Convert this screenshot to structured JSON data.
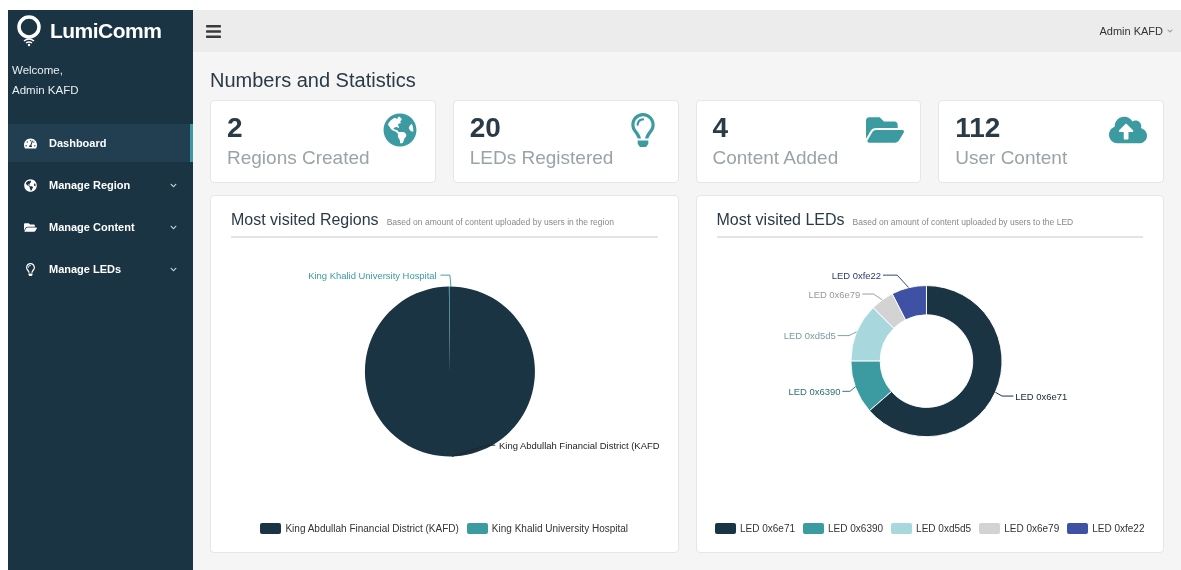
{
  "sidebar": {
    "brand": "LumiComm",
    "welcome": "Welcome,",
    "user": "Admin KAFD",
    "items": [
      {
        "label": "Dashboard",
        "selected": true,
        "has_children": false
      },
      {
        "label": "Manage Region",
        "selected": false,
        "has_children": true
      },
      {
        "label": "Manage Content",
        "selected": false,
        "has_children": true
      },
      {
        "label": "Manage LEDs",
        "selected": false,
        "has_children": true
      }
    ]
  },
  "topbar": {
    "user": "Admin KAFD"
  },
  "page_title": "Numbers and Statistics",
  "stats": [
    {
      "value": "2",
      "label": "Regions Created"
    },
    {
      "value": "20",
      "label": "LEDs Registered"
    },
    {
      "value": "4",
      "label": "Content Added"
    },
    {
      "value": "112",
      "label": "User Content"
    }
  ],
  "charts": [
    {
      "kind": "pie",
      "title": "Most visited Regions",
      "subtitle": "Based on amount of content uploaded by users in the region",
      "slices": [
        {
          "label": "King Khalid University Hospital",
          "color": "#3b9ba0"
        },
        {
          "label": "King Abdullah Financial District (KAFD",
          "color": "#1b3444"
        }
      ],
      "legend": [
        {
          "label": "King Abdullah Financial District (KAFD)",
          "color": "#1b3444"
        },
        {
          "label": "King Khalid University Hospital",
          "color": "#3b9ba0"
        }
      ]
    },
    {
      "kind": "donut",
      "title": "Most visited LEDs",
      "subtitle": "Based on amount of content uploaded by users to the LED",
      "slices": [
        {
          "label": "LED 0xfe22",
          "color": "#3f51a5"
        },
        {
          "label": "LED 0x6e79",
          "color": "#d3d3d3"
        },
        {
          "label": "LED 0xd5d5",
          "color": "#a8d8de"
        },
        {
          "label": "LED 0x6390",
          "color": "#3b9ba0"
        },
        {
          "label": "LED 0x6e71",
          "color": "#1b3444"
        }
      ],
      "legend": [
        {
          "label": "LED 0x6e71",
          "color": "#1b3444"
        },
        {
          "label": "LED 0x6390",
          "color": "#3b9ba0"
        },
        {
          "label": "LED 0xd5d5",
          "color": "#a8d8de"
        },
        {
          "label": "LED 0x6e79",
          "color": "#d3d3d3"
        },
        {
          "label": "LED 0xfe22",
          "color": "#3f51a5"
        }
      ]
    }
  ]
}
